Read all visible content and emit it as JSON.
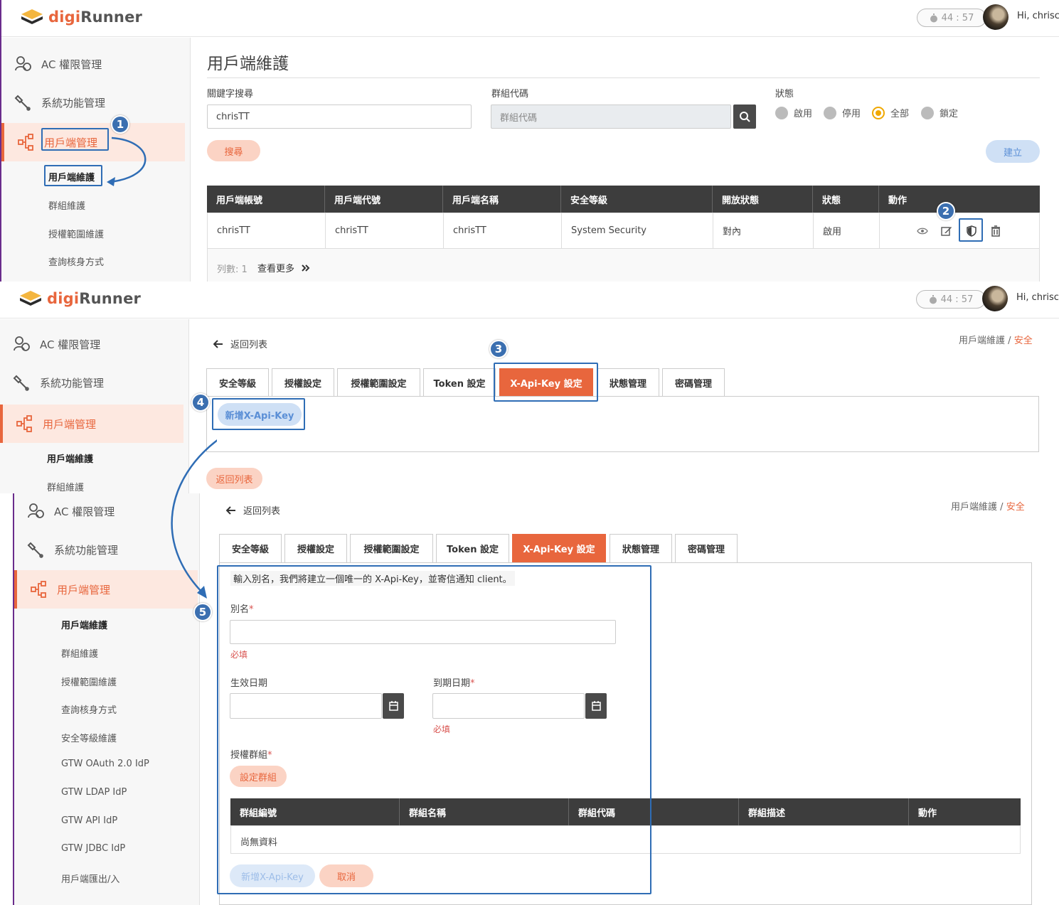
{
  "app": {
    "brand_prefix": "digi",
    "brand_suffix": "Runner",
    "timer": "44 : 57",
    "greeting": "Hi, chrisc"
  },
  "nav": {
    "ac": "AC 權限管理",
    "sys": "系統功能管理",
    "client": "用戶端管理",
    "subs": [
      "用戶端維護",
      "群組維護",
      "授權範圍維護",
      "查詢核身方式",
      "安全等級維護",
      "GTW OAuth 2.0 IdP",
      "GTW LDAP IdP",
      "GTW API IdP",
      "GTW JDBC IdP",
      "用戶端匯出/入"
    ]
  },
  "list_page": {
    "title": "用戶端維護",
    "keyword_label": "關鍵字搜尋",
    "keyword_value": "chrisTT",
    "group_label": "群組代碼",
    "group_placeholder": "群組代碼",
    "status_label": "狀態",
    "status_options": [
      "啟用",
      "停用",
      "全部",
      "鎖定"
    ],
    "status_selected": "全部",
    "search_button": "搜尋",
    "create_button": "建立",
    "columns": [
      "用戶端帳號",
      "用戶端代號",
      "用戶端名稱",
      "安全等級",
      "開放狀態",
      "狀態",
      "動作"
    ],
    "rows": [
      {
        "account": "chrisTT",
        "code": "chrisTT",
        "name": "chrisTT",
        "security": "System Security",
        "open": "對內",
        "status": "啟用"
      }
    ],
    "count_label": "列數:",
    "count_value": "1",
    "more_label": "查看更多"
  },
  "detail": {
    "back_label": "返回列表",
    "breadcrumb_parent": "用戶端維護",
    "breadcrumb_sep": "/",
    "breadcrumb_current": "安全",
    "tabs": [
      "安全等級",
      "授權設定",
      "授權範圍設定",
      "Token 設定",
      "X-Api-Key 設定",
      "狀態管理",
      "密碼管理"
    ],
    "active_tab": "X-Api-Key 設定",
    "add_key_button": "新增X-Api-Key",
    "back_button": "返回列表"
  },
  "form": {
    "intro": "輸入別名，我們將建立一個唯一的 X-Api-Key，並寄信通知 client。",
    "alias_label": "別名",
    "required_mark": "*",
    "required_msg": "必填",
    "start_label": "生效日期",
    "end_label": "到期日期",
    "group_label": "授權群組",
    "set_group_button": "設定群組",
    "group_columns": [
      "群組編號",
      "群組名稱",
      "群組代碼",
      "群組描述",
      "動作"
    ],
    "empty_text": "尚無資料",
    "submit_button": "新增X-Api-Key",
    "cancel_button": "取消"
  },
  "steps": [
    "1",
    "2",
    "3",
    "4",
    "5"
  ],
  "colors": {
    "accent": "#e8663d",
    "accent_light": "#fbd3c4",
    "blue": "#2f6db5",
    "header_dark": "#3d3d3d"
  },
  "icons": [
    "ac-users-icon",
    "wrench-icon",
    "network-icon",
    "search-icon",
    "eye-icon",
    "edit-icon",
    "shield-icon",
    "trash-icon",
    "arrow-left-icon",
    "calendar-icon",
    "stopwatch-icon",
    "chevron-double-right-icon"
  ]
}
